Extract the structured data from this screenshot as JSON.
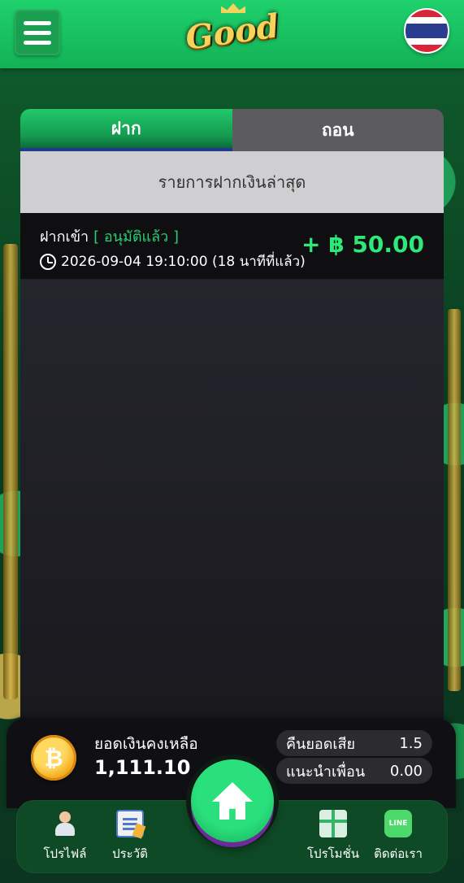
{
  "header": {
    "logo_text": "Good",
    "menu_icon": "hamburger-icon",
    "language_flag": "thailand-flag-icon"
  },
  "tabs": [
    {
      "label": "ฝาก",
      "active": true
    },
    {
      "label": "ถอน",
      "active": false
    }
  ],
  "list": {
    "heading": "รายการฝากเงินล่าสุด",
    "items": [
      {
        "title": "ฝากเข้า",
        "status": "[ อนุมัติแล้ว ]",
        "datetime": "2026-09-04 19:10:00 (18 นาทีที่แล้ว)",
        "amount": "+ ฿ 50.00"
      }
    ]
  },
  "balance": {
    "label": "ยอดเงินคงเหลือ",
    "value": "1,111.10",
    "coin_symbol": "₿",
    "cashback_label": "คืนยอดเสีย",
    "cashback_value": "1.5",
    "referral_label": "แนะนำเพื่อน",
    "referral_value": "0.00"
  },
  "nav": {
    "profile": "โปรไฟล์",
    "history": "ประวัติ",
    "promotion": "โปรโมชั่น",
    "contact": "ติดต่อเรา",
    "line_badge": "LINE"
  },
  "colors": {
    "accent": "#1fd16c",
    "amount_green": "#2ee87a",
    "status_green": "#2ecc71"
  }
}
